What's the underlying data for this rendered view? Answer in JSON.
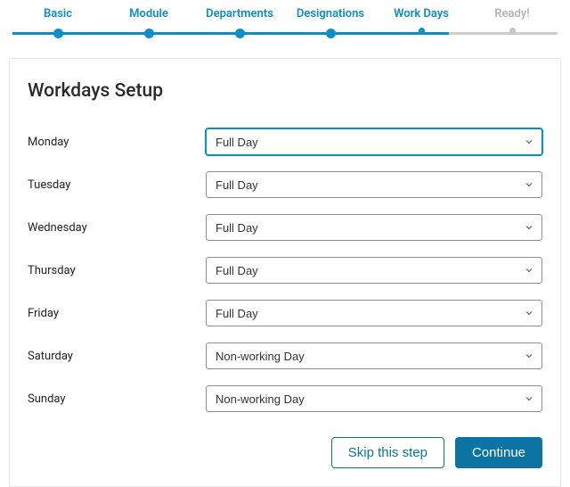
{
  "stepper": {
    "steps": [
      {
        "label": "Basic",
        "state": "done"
      },
      {
        "label": "Module",
        "state": "done"
      },
      {
        "label": "Departments",
        "state": "done"
      },
      {
        "label": "Designations",
        "state": "done"
      },
      {
        "label": "Work Days",
        "state": "current"
      },
      {
        "label": "Ready!",
        "state": "future"
      }
    ]
  },
  "panel": {
    "title": "Workdays Setup",
    "days": [
      {
        "name": "Monday",
        "value": "Full Day",
        "focused": true
      },
      {
        "name": "Tuesday",
        "value": "Full Day",
        "focused": false
      },
      {
        "name": "Wednesday",
        "value": "Full Day",
        "focused": false
      },
      {
        "name": "Thursday",
        "value": "Full Day",
        "focused": false
      },
      {
        "name": "Friday",
        "value": "Full Day",
        "focused": false
      },
      {
        "name": "Saturday",
        "value": "Non-working Day",
        "focused": false
      },
      {
        "name": "Sunday",
        "value": "Non-working Day",
        "focused": false
      }
    ]
  },
  "footer": {
    "skip_label": "Skip this step",
    "continue_label": "Continue"
  }
}
